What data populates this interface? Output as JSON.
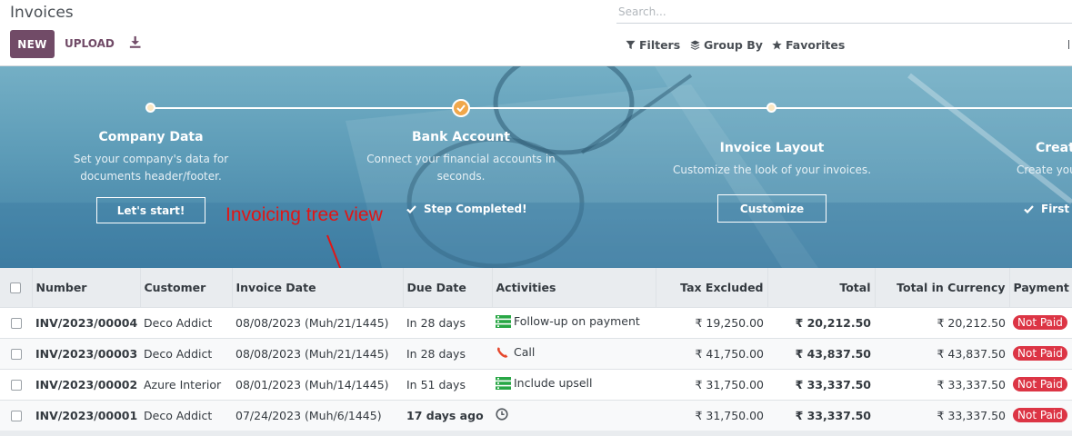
{
  "header": {
    "title": "Invoices",
    "new_label": "NEW",
    "upload_label": "UPLOAD",
    "search_placeholder": "Search...",
    "filters_label": "Filters",
    "groupby_label": "Group By",
    "favorites_label": "Favorites"
  },
  "onboarding": {
    "steps": [
      {
        "title": "Company Data",
        "desc": "Set your company's data for documents header/footer.",
        "button": "Let's start!"
      },
      {
        "title": "Bank Account",
        "desc": "Connect your financial accounts in seconds.",
        "done": "Step Completed!"
      },
      {
        "title": "Invoice Layout",
        "desc": "Customize the look of your invoices.",
        "button": "Customize"
      },
      {
        "title": "Creat",
        "desc": "Create you",
        "done": "First"
      }
    ],
    "annotation": "Invoicing tree view"
  },
  "table": {
    "columns": [
      "Number",
      "Customer",
      "Invoice Date",
      "Due Date",
      "Activities",
      "Tax Excluded",
      "Total",
      "Total in Currency",
      "Payment St"
    ],
    "rows": [
      {
        "number": "INV/2023/00004",
        "customer": "Deco Addict",
        "invoice_date": "08/08/2023 (Muh/21/1445)",
        "due": "In 28 days",
        "activity": "Follow-up on payment",
        "activity_icon": "tasks-icon",
        "tax_excl": "₹ 19,250.00",
        "total": "₹ 20,212.50",
        "total_cur": "₹ 20,212.50",
        "status": "Not Paid"
      },
      {
        "number": "INV/2023/00003",
        "customer": "Deco Addict",
        "invoice_date": "08/08/2023 (Muh/21/1445)",
        "due": "In 28 days",
        "activity": "Call",
        "activity_icon": "phone-icon",
        "tax_excl": "₹ 41,750.00",
        "total": "₹ 43,837.50",
        "total_cur": "₹ 43,837.50",
        "status": "Not Paid"
      },
      {
        "number": "INV/2023/00002",
        "customer": "Azure Interior",
        "invoice_date": "08/01/2023 (Muh/14/1445)",
        "due": "In 51 days",
        "activity": "Include upsell",
        "activity_icon": "tasks-icon",
        "tax_excl": "₹ 31,750.00",
        "total": "₹ 33,337.50",
        "total_cur": "₹ 33,337.50",
        "status": "Not Paid"
      },
      {
        "number": "INV/2023/00001",
        "customer": "Deco Addict",
        "invoice_date": "07/24/2023 (Muh/6/1445)",
        "due": "17 days ago",
        "activity": "",
        "activity_icon": "clock-icon",
        "tax_excl": "₹ 31,750.00",
        "total": "₹ 33,337.50",
        "total_cur": "₹ 33,337.50",
        "status": "Not Paid"
      }
    ]
  },
  "colors": {
    "brand": "#714b67",
    "danger": "#dc3545",
    "overdue": "#d23f3a",
    "activity_green": "#28a745",
    "phone_red": "#e6482d"
  }
}
